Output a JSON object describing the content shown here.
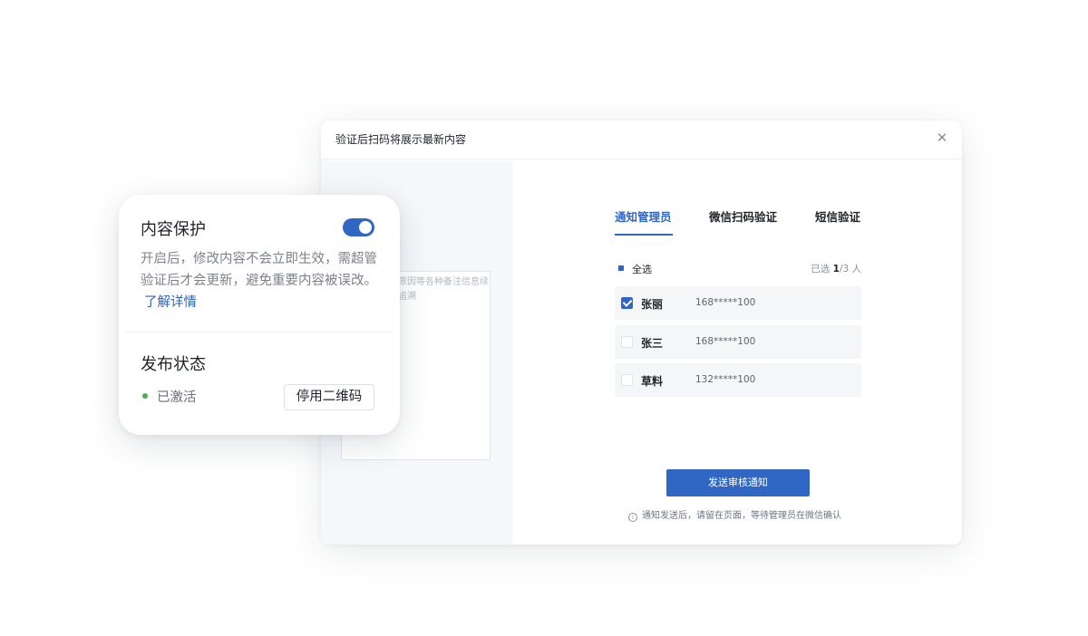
{
  "modal": {
    "title": "验证后扫码将展示最新内容",
    "close_icon": "close-icon",
    "left_note": "原因等各种备注信息续追溯",
    "tabs": [
      {
        "label": "通知管理员",
        "active": true
      },
      {
        "label": "微信扫码验证",
        "active": false
      },
      {
        "label": "短信验证",
        "active": false
      }
    ],
    "select_all": {
      "label": "全选",
      "count_prefix": "已选 ",
      "selected": "1",
      "count_suffix": "/3 人"
    },
    "members": [
      {
        "name": "张丽",
        "phone": "168*****100",
        "checked": true
      },
      {
        "name": "张三",
        "phone": "168*****100",
        "checked": false
      },
      {
        "name": "草料",
        "phone": "132*****100",
        "checked": false
      }
    ],
    "send_button": "发送审核通知",
    "hint": "通知发送后，请留在页面，等待管理员在微信确认",
    "hint_icon": "info-icon",
    "accent_color": "#3167c4"
  },
  "card": {
    "title": "内容保护",
    "toggle_on": true,
    "description": "开启后，修改内容不会立即生效，需超管验证后才会更新，避免重要内容被误改。",
    "link": "了解详情",
    "status_title": "发布状态",
    "status_text": "已激活",
    "status_color": "#4caf50",
    "disable_button": "停用二维码"
  }
}
